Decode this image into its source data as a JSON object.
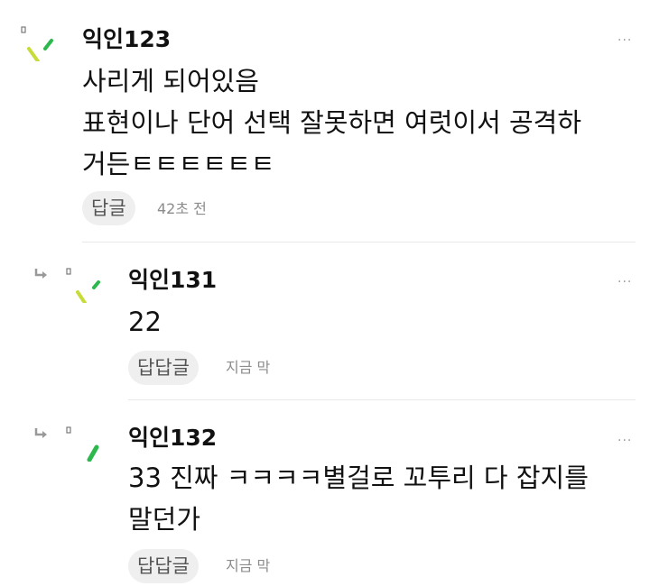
{
  "comments": [
    {
      "author": "익인123",
      "lines": [
        "사리게 되어있음",
        "표현이나 단어 선택 잘못하면 여럿이서 공격하",
        "거든ㅌㅌㅌㅌㅌㅌ"
      ],
      "reply_label": "답글",
      "time": "42초 전",
      "more": "···"
    }
  ],
  "replies": [
    {
      "author": "익인131",
      "lines": [
        "22"
      ],
      "reply_label": "답답글",
      "time": "지금 막",
      "more": "···"
    },
    {
      "author": "익인132",
      "lines": [
        "33 진짜 ㅋㅋㅋㅋ별걸로 꼬투리 다 잡지를",
        "말던가"
      ],
      "reply_label": "답답글",
      "time": "지금 막",
      "more": "···"
    }
  ],
  "colors": {
    "avatar_lime": "#c7dc3a",
    "avatar_green": "#2db84d",
    "avatar_dot": "#7a7a7a",
    "pill_bg": "#efefef",
    "divider": "#e8e8e8"
  },
  "icons": {
    "avatar": "avatar-icon",
    "reply_arrow": "reply-arrow-icon",
    "more": "more-icon"
  }
}
